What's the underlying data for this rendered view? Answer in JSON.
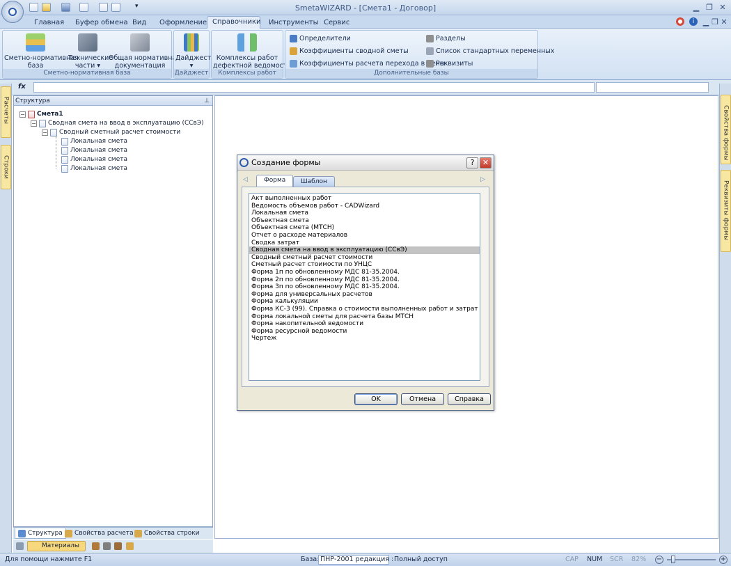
{
  "window": {
    "title": "SmetaWIZARD - [Смета1 - Договор]"
  },
  "ribbon_tabs": [
    "Главная",
    "Буфер обмена",
    "Вид",
    "Оформление",
    "Справочники",
    "Инструменты",
    "Сервис"
  ],
  "active_tab": "Справочники",
  "ribbon": {
    "g1": {
      "label": "Сметно-нормативная база",
      "b1": [
        "Сметно-нормативная",
        "база"
      ],
      "b2": [
        "Технические",
        "части"
      ],
      "b3": [
        "Общая нормативная",
        "документация"
      ]
    },
    "g2": {
      "label": "Дайджест",
      "b1": "Дайджест"
    },
    "g3": {
      "label": "Комплексы работ",
      "b1": [
        "Комплексы работ",
        "дефектной ведомости"
      ]
    },
    "g4": {
      "label": "Дополнительные базы",
      "items": [
        "Определители",
        "Коэффициенты сводной сметы",
        "Коэффициенты расчета перехода в цены",
        "Разделы",
        "Список стандартных переменных",
        "Реквизиты"
      ]
    }
  },
  "fx_label": "fx",
  "side": {
    "left": [
      "Расчеты",
      "Строки"
    ],
    "right": [
      "Свойства формы",
      "Реквизиты формы"
    ]
  },
  "structure": {
    "title": "Структура",
    "root": "Смета1",
    "child": "Сводная смета на ввод в эксплуатацию (ССвЭ)",
    "grandchild": "Сводный сметный расчет стоимости",
    "leaves": [
      "Локальная смета",
      "Локальная смета",
      "Локальная смета",
      "Локальная смета"
    ]
  },
  "bottom_tabs": [
    "Структура",
    "Свойства расчета",
    "Свойства строки"
  ],
  "materials_label": "Материалы",
  "dialog": {
    "title": "Создание формы",
    "tabs": [
      "Форма",
      "Шаблон"
    ],
    "items": [
      "Акт выполненных работ",
      "Ведомость объемов работ - CADWizard",
      "Локальная смета",
      "Объектная смета",
      "Объектная смета (МТСН)",
      "Отчет о расходе материалов",
      "Сводка затрат",
      "Сводная смета на ввод в эксплуатацию (ССвЭ)",
      "Сводный сметный расчет стоимости",
      "Сметный расчет стоимости по УНЦС",
      "Форма 1п по обновленному МДС 81-35.2004.",
      "Форма 2п по обновленному МДС 81-35.2004.",
      "Форма 3п по обновленному МДС 81-35.2004.",
      "Форма для универсальных расчетов",
      "Форма калькуляции",
      "Форма КС-3 (99). Справка о стоимости выполненных работ и затрат",
      "Форма локальной сметы для расчета базы МТСН",
      "Форма накопительной ведомости",
      "Форма ресурсной ведомости",
      "Чертеж"
    ],
    "selected_index": 7,
    "ok": "OK",
    "cancel": "Отмена",
    "help": "Справка"
  },
  "status": {
    "help": "Для помощи нажмите F1",
    "base_label": "База:",
    "base_value": "ПНР-2001 редакция :",
    "access": "Полный доступ",
    "cap": "CAP",
    "num": "NUM",
    "scr": "SCR",
    "zoom": "82%"
  }
}
